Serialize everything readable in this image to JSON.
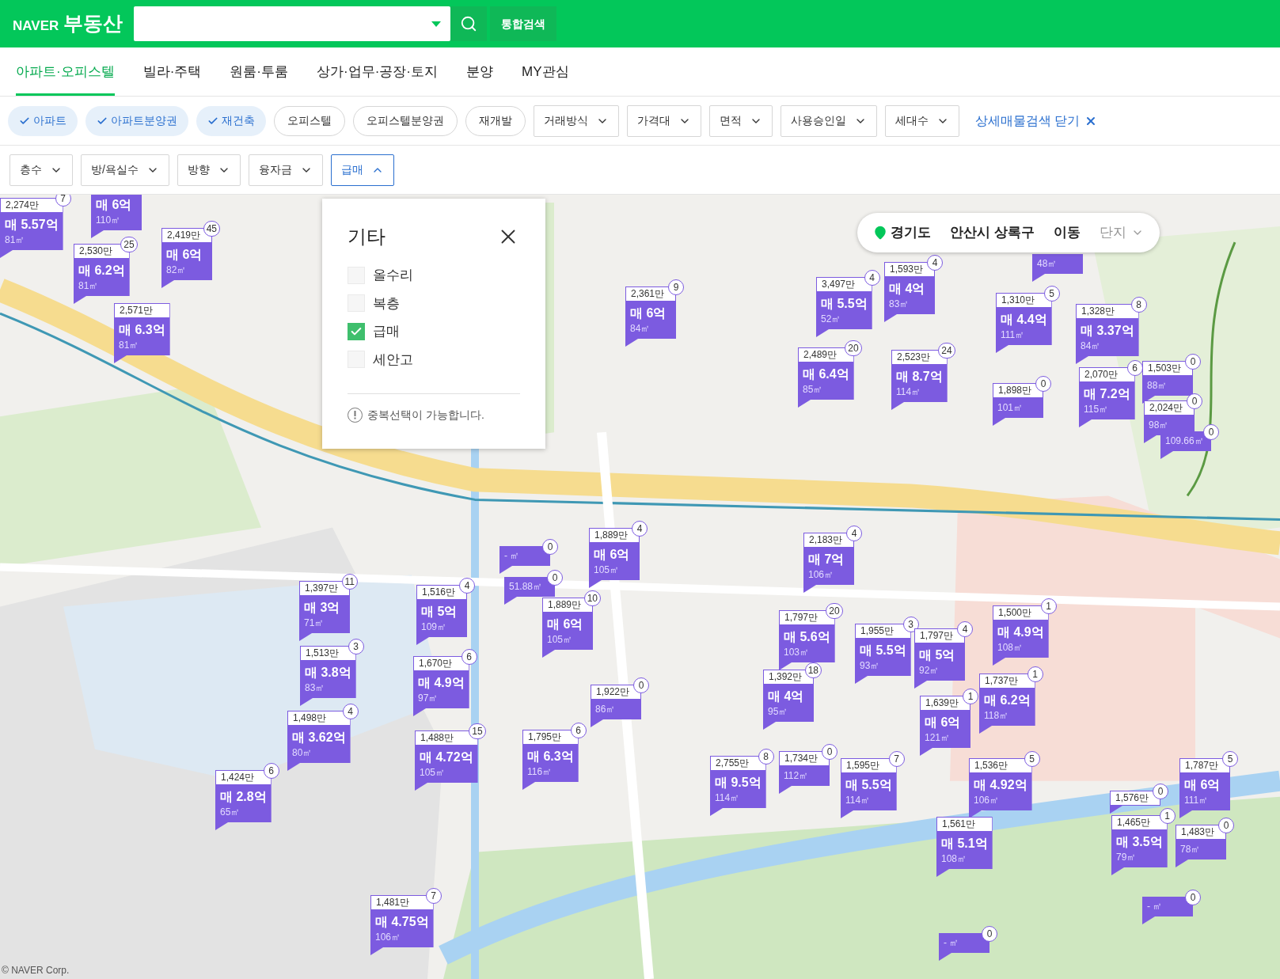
{
  "header": {
    "brand": "NAVER",
    "service": "부동산",
    "search_button": "통합검색"
  },
  "tabs": [
    {
      "label": "아파트·오피스텔",
      "selected": true
    },
    {
      "label": "빌라·주택",
      "selected": false
    },
    {
      "label": "원룸·투룸",
      "selected": false
    },
    {
      "label": "상가·업무·공장·토지",
      "selected": false
    },
    {
      "label": "분양",
      "selected": false
    },
    {
      "label": "MY관심",
      "selected": false
    }
  ],
  "filters": [
    {
      "kind": "chip",
      "label": "아파트",
      "selected": true
    },
    {
      "kind": "chip",
      "label": "아파트분양권",
      "selected": true
    },
    {
      "kind": "chip",
      "label": "재건축",
      "selected": true
    },
    {
      "kind": "chip",
      "label": "오피스텔",
      "selected": false
    },
    {
      "kind": "chip",
      "label": "오피스텔분양권",
      "selected": false
    },
    {
      "kind": "chip",
      "label": "재개발",
      "selected": false
    },
    {
      "kind": "dropdown",
      "label": "거래방식",
      "expanded": false
    },
    {
      "kind": "dropdown",
      "label": "가격대",
      "expanded": false
    },
    {
      "kind": "dropdown",
      "label": "면적",
      "expanded": false
    },
    {
      "kind": "dropdown",
      "label": "사용승인일",
      "expanded": false
    },
    {
      "kind": "dropdown",
      "label": "세대수",
      "expanded": false
    },
    {
      "kind": "link",
      "label": "상세매물검색 닫기"
    }
  ],
  "filters_2": [
    {
      "label": "층수",
      "expanded": false
    },
    {
      "label": "방/욕실수",
      "expanded": false
    },
    {
      "label": "방향",
      "expanded": false
    },
    {
      "label": "융자금",
      "expanded": false
    },
    {
      "label": "급매",
      "expanded": true
    }
  ],
  "popup": {
    "title": "기타",
    "options": [
      {
        "label": "올수리",
        "checked": false
      },
      {
        "label": "복층",
        "checked": false
      },
      {
        "label": "급매",
        "checked": true
      },
      {
        "label": "세안고",
        "checked": false
      }
    ],
    "note": "중복선택이 가능합니다."
  },
  "location": {
    "region": "경기도",
    "city": "안산시 상록구",
    "dong": "이동",
    "complex": "단지"
  },
  "markers": [
    {
      "price_per": "2,274만",
      "count": "7",
      "price": "매 5.57억",
      "area": "81㎡"
    },
    {
      "price": "매 6억",
      "area": "110㎡"
    },
    {
      "price_per": "2,530만",
      "count": "25",
      "price": "매 6.2억",
      "area": "81㎡"
    },
    {
      "price_per": "2,419만",
      "count": "45",
      "price": "매 6억",
      "area": "82㎡"
    },
    {
      "price_per": "2,571만",
      "price": "매 6.3억",
      "area": "81㎡"
    },
    {
      "price_per": "2,361만",
      "count": "9",
      "price": "매 6억",
      "area": "84㎡"
    },
    {
      "area": "48㎡"
    },
    {
      "price_per": "3,497만",
      "count": "4",
      "price": "매 5.5억",
      "area": "52㎡"
    },
    {
      "price_per": "1,593만",
      "count": "4",
      "price": "매 4억",
      "area": "83㎡"
    },
    {
      "price_per": "2,489만",
      "count": "20",
      "price": "매 6.4억",
      "area": "85㎡"
    },
    {
      "price_per": "2,523만",
      "count": "24",
      "price": "매 8.7억",
      "area": "114㎡"
    },
    {
      "price_per": "1,310만",
      "count": "5",
      "price": "매 4.4억",
      "area": "111㎡"
    },
    {
      "price_per": "1,898만",
      "count": "0",
      "area": "101㎡"
    },
    {
      "price_per": "1,328만",
      "count": "8",
      "price": "매 3.37억",
      "area": "84㎡"
    },
    {
      "price_per": "2,070만",
      "count": "6",
      "price": "매 7.2억",
      "area": "115㎡"
    },
    {
      "price_per": "1,503만",
      "count": "0",
      "area": "88㎡"
    },
    {
      "price_per": "2,024만",
      "count": "0",
      "area": "98㎡"
    },
    {
      "count": "0",
      "area": "109.66㎡"
    },
    {
      "count": "0",
      "area": "- ㎡"
    },
    {
      "price_per": "1,889만",
      "count": "4",
      "price": "매 6억",
      "area": "105㎡"
    },
    {
      "price_per": "2,183만",
      "count": "4",
      "price": "매 7억",
      "area": "106㎡"
    },
    {
      "price_per": "1,397만",
      "count": "11",
      "price": "매 3억",
      "area": "71㎡"
    },
    {
      "price_per": "1,516만",
      "count": "4",
      "price": "매 5억",
      "area": "109㎡"
    },
    {
      "count": "0",
      "area": "51.88㎡"
    },
    {
      "price_per": "1,889만",
      "count": "10",
      "price": "매 6억",
      "area": "105㎡"
    },
    {
      "price_per": "1,797만",
      "count": "20",
      "price": "매 5.6억",
      "area": "103㎡"
    },
    {
      "price_per": "1,955만",
      "count": "3",
      "price": "매 5.5억",
      "area": "93㎡"
    },
    {
      "price_per": "1,797만",
      "count": "4",
      "price": "매 5억",
      "area": "92㎡"
    },
    {
      "price_per": "1,500만",
      "count": "1",
      "price": "매 4.9억",
      "area": "108㎡"
    },
    {
      "price_per": "1,513만",
      "count": "3",
      "price": "매 3.8억",
      "area": "83㎡"
    },
    {
      "price_per": "1,670만",
      "count": "6",
      "price": "매 4.9억",
      "area": "97㎡"
    },
    {
      "price_per": "1,922만",
      "count": "0",
      "area": "86㎡"
    },
    {
      "price_per": "1,392만",
      "count": "18",
      "price": "매 4억",
      "area": "95㎡"
    },
    {
      "price_per": "1,639만",
      "count": "1",
      "price": "매 6억",
      "area": "121㎡"
    },
    {
      "price_per": "1,737만",
      "count": "1",
      "price": "매 6.2억",
      "area": "118㎡"
    },
    {
      "price_per": "1,498만",
      "count": "4",
      "price": "매 3.62억",
      "area": "80㎡"
    },
    {
      "price_per": "1,488만",
      "count": "15",
      "price": "매 4.72억",
      "area": "105㎡"
    },
    {
      "price_per": "1,795만",
      "count": "6",
      "price": "매 6.3억",
      "area": "116㎡"
    },
    {
      "price_per": "2,755만",
      "count": "8",
      "price": "매 9.5억",
      "area": "114㎡"
    },
    {
      "price_per": "1,734만",
      "count": "0",
      "area": "112㎡"
    },
    {
      "price_per": "1,595만",
      "count": "7",
      "price": "매 5.5억",
      "area": "114㎡"
    },
    {
      "price_per": "1,536만",
      "count": "5",
      "price": "매 4.92억",
      "area": "106㎡"
    },
    {
      "price_per": "1,787만",
      "count": "5",
      "price": "매 6억",
      "area": "111㎡"
    },
    {
      "price_per": "1,424만",
      "count": "6",
      "price": "매 2.8억",
      "area": "65㎡"
    },
    {
      "price_per": "1,576만",
      "count": "0"
    },
    {
      "price_per": "1,561만",
      "price": "매 5.1억",
      "area": "108㎡"
    },
    {
      "price_per": "1,465만",
      "count": "1",
      "price": "매 3.5억",
      "area": "79㎡"
    },
    {
      "price_per": "1,483만",
      "count": "0",
      "area": "78㎡"
    },
    {
      "price_per": "1,481만",
      "count": "7",
      "price": "매 4.75억",
      "area": "106㎡"
    },
    {
      "count": "0",
      "area": "- ㎡"
    },
    {
      "count": "0",
      "area": "- ㎡"
    }
  ],
  "copyright": "© NAVER Corp."
}
